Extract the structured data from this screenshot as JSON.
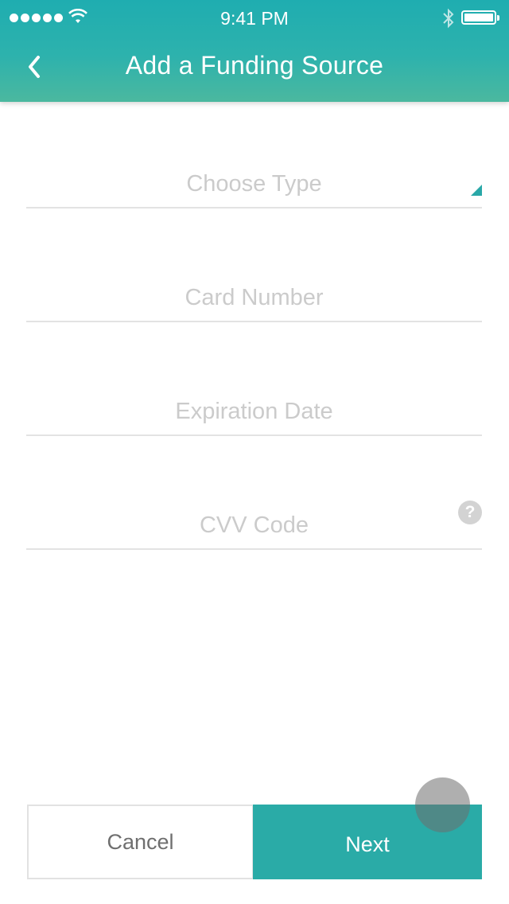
{
  "status_bar": {
    "time": "9:41 PM",
    "signal_icon": "signal-dots-icon",
    "wifi_icon": "wifi-icon",
    "bluetooth_icon": "bluetooth-icon",
    "battery_icon": "battery-icon",
    "battery_level": 1.0
  },
  "header": {
    "title": "Add a Funding Source",
    "back_icon": "chevron-left-icon",
    "gradient": [
      "#1fadb0",
      "#4bb89f"
    ]
  },
  "form": {
    "type_field": {
      "placeholder": "Choose Type",
      "icon": "dropdown-triangle-icon"
    },
    "card_number": {
      "placeholder": "Card Number"
    },
    "expiration_date": {
      "placeholder": "Expiration Date"
    },
    "cvv": {
      "placeholder": "CVV Code",
      "help_glyph": "?",
      "icon": "help-icon"
    }
  },
  "actions": {
    "cancel_label": "Cancel",
    "next_label": "Next",
    "accent_color": "#2aaba7"
  }
}
